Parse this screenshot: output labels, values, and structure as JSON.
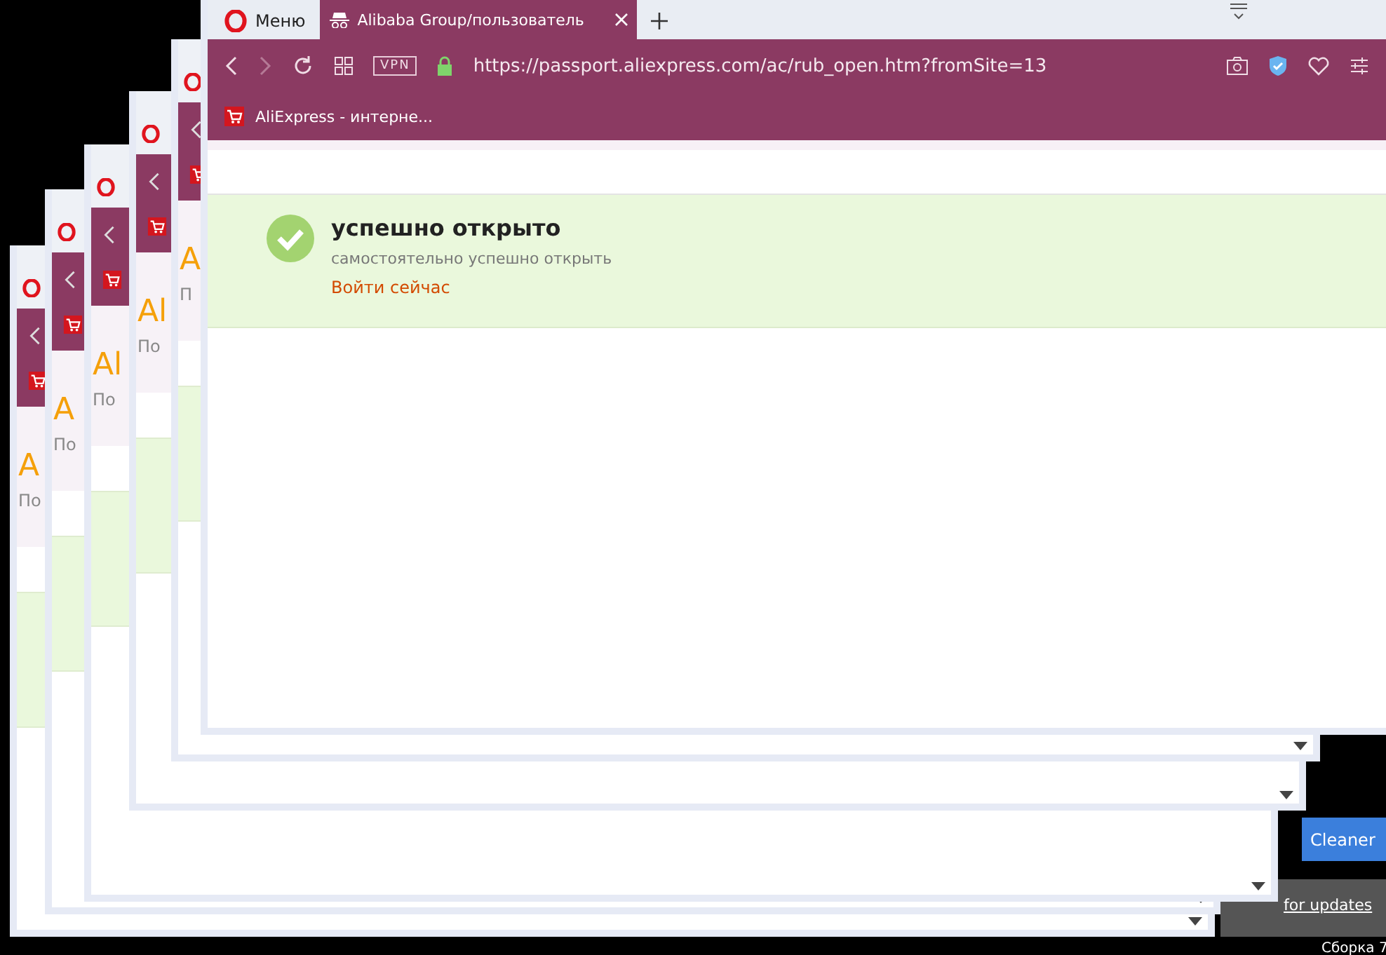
{
  "background_windows": [
    {
      "heading": "A",
      "subtitle": "По"
    },
    {
      "heading": "A",
      "subtitle": "По"
    },
    {
      "heading": "Al",
      "subtitle": "По"
    },
    {
      "heading": "Al",
      "subtitle": "По"
    },
    {
      "heading": "A",
      "subtitle": "П"
    }
  ],
  "desktop": {
    "cleaner_button": "Cleaner",
    "updates_link": "for updates",
    "build_label": "Сборка 7"
  },
  "browser": {
    "menu": "Меню",
    "tab": {
      "title": "Alibaba Group/пользователь",
      "selected": true
    },
    "url": "https://passport.aliexpress.com/ac/rub_open.htm?fromSite=13",
    "vpn": "VPN",
    "bookmark": "AliExpress - интерне...",
    "message": {
      "title": "успешно открыто",
      "text": "самостоятельно успешно открыть",
      "link": "Войти сейчас"
    }
  }
}
